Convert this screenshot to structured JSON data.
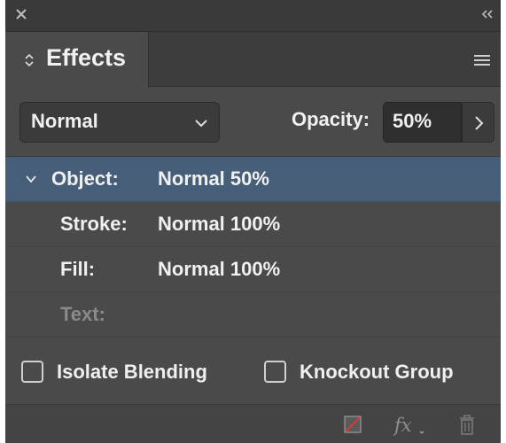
{
  "panel": {
    "title": "Effects",
    "icons": {
      "close": "close-icon",
      "collapse": "double-chevron-left-icon",
      "tab_reorder": "chevron-up-down-icon",
      "menu": "hamburger-menu-icon"
    }
  },
  "controls": {
    "blend_mode": "Normal",
    "opacity_label": "Opacity:",
    "opacity_value": "50%"
  },
  "effects": [
    {
      "label": "Object:",
      "value": "Normal 50%",
      "selected": true,
      "expanded": true,
      "enabled": true
    },
    {
      "label": "Stroke:",
      "value": "Normal 100%",
      "selected": false,
      "enabled": true
    },
    {
      "label": "Fill:",
      "value": "Normal 100%",
      "selected": false,
      "enabled": true
    },
    {
      "label": "Text:",
      "value": "",
      "selected": false,
      "enabled": false
    }
  ],
  "options": {
    "isolate_blending": {
      "label": "Isolate Blending",
      "checked": false
    },
    "knockout_group": {
      "label": "Knockout Group",
      "checked": false
    }
  },
  "bottom_bar": {
    "icons": [
      "clear-effects-icon",
      "fx-icon",
      "trash-icon"
    ]
  },
  "colors": {
    "panel_bg": "#4a4a4a",
    "selection": "#475e78",
    "text": "#f0f0f0",
    "disabled_text": "#8a8a8a"
  }
}
